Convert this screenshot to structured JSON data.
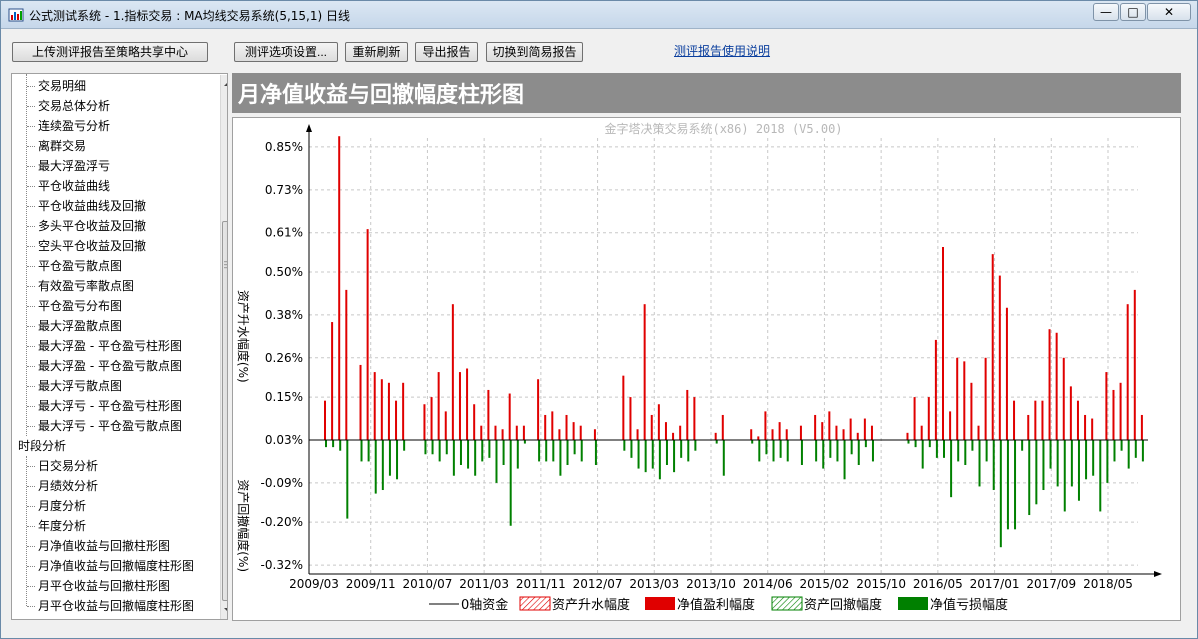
{
  "window": {
    "title": "公式测试系统 - 1.指标交易 : MA均线交易系统(5,15,1) 日线",
    "minimize_label": "—",
    "maximize_label": "□",
    "close_label": "✕"
  },
  "toolbar": {
    "upload_label": "上传测评报告至策略共享中心",
    "options_label": "测评选项设置...",
    "refresh_label": "重新刷新",
    "export_label": "导出报告",
    "simple_label": "切换到简易报告",
    "help_link": "测评报告使用说明"
  },
  "tree": {
    "items_a": [
      "交易明细",
      "交易总体分析",
      "连续盈亏分析",
      "离群交易",
      "最大浮盈浮亏",
      "平仓收益曲线",
      "平仓收益曲线及回撤",
      "多头平仓收益及回撤",
      "空头平仓收益及回撤",
      "平仓盈亏散点图",
      "有效盈亏率散点图",
      "平仓盈亏分布图",
      "最大浮盈散点图",
      "最大浮盈 - 平仓盈亏柱形图",
      "最大浮盈 - 平仓盈亏散点图",
      "最大浮亏散点图",
      "最大浮亏 - 平仓盈亏柱形图",
      "最大浮亏 - 平仓盈亏散点图"
    ],
    "group": "时段分析",
    "items_b": [
      "日交易分析",
      "月绩效分析",
      "月度分析",
      "年度分析",
      "月净值收益与回撤柱形图",
      "月净值收益与回撤幅度柱形图",
      "月平仓收益与回撤柱形图",
      "月平仓收益与回撤幅度柱形图"
    ]
  },
  "panel": {
    "title": "月净值收益与回撤幅度柱形图"
  },
  "chart_data": {
    "type": "bar",
    "watermark": "金字塔决策交易系统(x86) 2018 (V5.00)",
    "ylabel_pos": "资产升水幅度(%)",
    "ylabel_neg": "资产回撤幅度(%)",
    "ylim": [
      -0.345,
      0.875
    ],
    "yticks": [
      "0.85%",
      "0.73%",
      "0.61%",
      "0.50%",
      "0.38%",
      "0.26%",
      "0.15%",
      "0.03%",
      "-0.09%",
      "-0.20%",
      "-0.32%"
    ],
    "ytick_values": [
      0.85,
      0.73,
      0.61,
      0.5,
      0.38,
      0.26,
      0.15,
      0.03,
      -0.09,
      -0.2,
      -0.32
    ],
    "xticks": [
      "2009/03",
      "2009/11",
      "2010/07",
      "2011/03",
      "2011/11",
      "2012/07",
      "2013/03",
      "2013/10",
      "2014/06",
      "2015/02",
      "2015/10",
      "2016/05",
      "2017/01",
      "2017/09",
      "2018/05"
    ],
    "grid": true,
    "baseline": 0.03,
    "colors": {
      "gain": "#e00000",
      "loss": "#008000"
    },
    "legend": [
      "0轴资金",
      "资产升水幅度",
      "净值盈利幅度",
      "资产回撤幅度",
      "净值亏损幅度"
    ],
    "months": 116,
    "gains": [
      0.11,
      0.33,
      0.85,
      0.42,
      0,
      0.21,
      0.59,
      0.19,
      0.17,
      0.16,
      0.11,
      0.16,
      0,
      0,
      0.1,
      0.12,
      0.19,
      0.08,
      0.38,
      0.19,
      0.2,
      0.1,
      0.04,
      0.14,
      0.04,
      0.03,
      0.13,
      0.04,
      0.04,
      0,
      0.17,
      0.07,
      0.08,
      0.03,
      0.07,
      0.05,
      0.04,
      0,
      0.03,
      0,
      0,
      0,
      0.18,
      0.12,
      0.03,
      0.38,
      0.07,
      0.1,
      0.05,
      0.02,
      0.04,
      0.14,
      0.12,
      0,
      0,
      0.02,
      0.07,
      0,
      0,
      0,
      0.03,
      0.01,
      0.08,
      0.03,
      0.05,
      0.03,
      0,
      0.04,
      0,
      0.07,
      0.05,
      0.08,
      0.04,
      0.03,
      0.06,
      0.02,
      0.06,
      0.04,
      0,
      0,
      0,
      0,
      0.02,
      0.12,
      0.04,
      0.12,
      0.28,
      0.54,
      0.08,
      0.23,
      0.22,
      0.16,
      0.04,
      0.23,
      0.52,
      0.46,
      0.37,
      0.11,
      0,
      0.07,
      0.11,
      0.11,
      0.31,
      0.3,
      0.23,
      0.15,
      0.11,
      0.07,
      0.06,
      0,
      0.19,
      0.14,
      0.16,
      0.38,
      0.42,
      0.07
    ],
    "losses": [
      -0.02,
      -0.02,
      -0.03,
      -0.22,
      0,
      -0.06,
      -0.06,
      -0.15,
      -0.14,
      -0.1,
      -0.11,
      -0.03,
      0,
      0,
      -0.04,
      -0.04,
      -0.06,
      -0.04,
      -0.1,
      -0.07,
      -0.08,
      -0.1,
      -0.06,
      -0.05,
      -0.12,
      -0.07,
      -0.24,
      -0.08,
      -0.01,
      0,
      -0.06,
      -0.06,
      -0.06,
      -0.1,
      -0.07,
      -0.04,
      -0.06,
      0,
      -0.07,
      0,
      0,
      0,
      -0.03,
      -0.05,
      -0.08,
      -0.09,
      -0.08,
      -0.11,
      -0.07,
      -0.09,
      -0.05,
      -0.06,
      -0.03,
      0,
      0,
      -0.01,
      -0.1,
      0,
      0,
      0,
      -0.01,
      -0.06,
      -0.04,
      -0.06,
      -0.05,
      -0.06,
      0,
      -0.07,
      0,
      -0.06,
      -0.08,
      -0.05,
      -0.06,
      -0.11,
      -0.04,
      -0.07,
      -0.02,
      -0.06,
      0,
      0,
      0,
      0,
      -0.01,
      -0.02,
      -0.08,
      -0.02,
      -0.05,
      -0.05,
      -0.16,
      -0.06,
      -0.07,
      -0.03,
      -0.13,
      -0.06,
      -0.14,
      -0.3,
      -0.25,
      -0.25,
      -0.03,
      -0.21,
      -0.18,
      -0.14,
      -0.08,
      -0.13,
      -0.2,
      -0.13,
      -0.17,
      -0.11,
      -0.1,
      -0.2,
      -0.12,
      -0.06,
      -0.03,
      -0.08,
      -0.05,
      -0.06
    ]
  }
}
